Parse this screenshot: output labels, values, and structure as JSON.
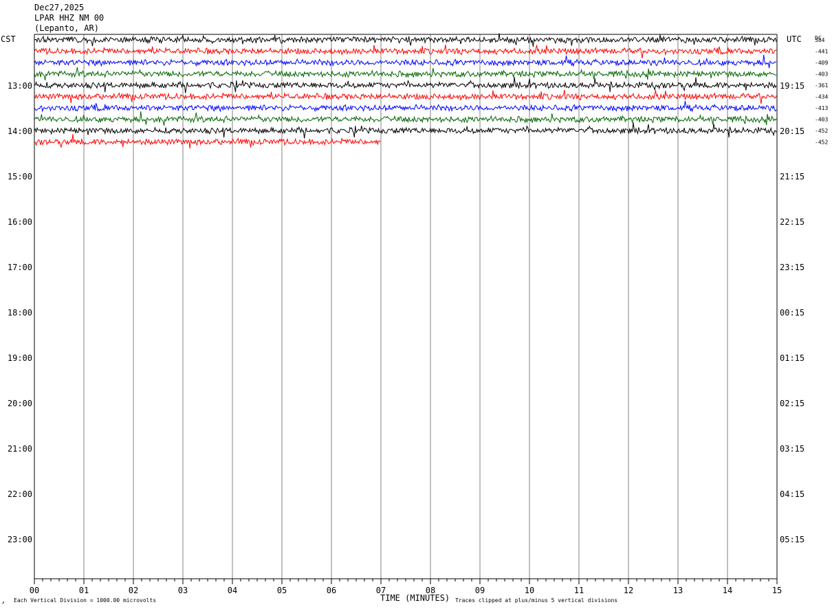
{
  "header": {
    "date": "Dec27,2025",
    "station": "LPAR HHZ NM 00",
    "location": "(Lepanto, AR)"
  },
  "corner": {
    "left_tz": "CST",
    "right_tz": "UTC",
    "dc": "DC"
  },
  "footer": {
    "division_note": "Each Vertical Division = 1000.00 microvolts",
    "clip_note": "Traces clipped at plus/minus 5 vertical divisions",
    "mark": "↗"
  },
  "chart_data": {
    "type": "line",
    "title": "LPAR HHZ NM 00",
    "xlabel": "TIME (MINUTES)",
    "x_ticks": [
      "00",
      "01",
      "02",
      "03",
      "04",
      "05",
      "06",
      "07",
      "08",
      "09",
      "10",
      "11",
      "12",
      "13",
      "14",
      "15"
    ],
    "xlim": [
      0,
      15
    ],
    "grid": true,
    "left_hour_labels": [
      "13:00",
      "14:00",
      "15:00",
      "16:00",
      "17:00",
      "18:00",
      "19:00",
      "20:00",
      "21:00",
      "22:00",
      "23:00"
    ],
    "right_hour_labels": [
      "19:15",
      "20:15",
      "21:15",
      "22:15",
      "23:15",
      "00:15",
      "01:15",
      "02:15",
      "03:15",
      "04:15",
      "05:15"
    ],
    "trace_colors": [
      "#000000",
      "#ff0000",
      "#0000ff",
      "#006400"
    ],
    "traces": [
      {
        "dc": "384",
        "color": "#000000",
        "end_minute": 15
      },
      {
        "dc": "-441",
        "color": "#ff0000",
        "end_minute": 15
      },
      {
        "dc": "-409",
        "color": "#0000ff",
        "end_minute": 15
      },
      {
        "dc": "-403",
        "color": "#006400",
        "end_minute": 15
      },
      {
        "dc": "-361",
        "color": "#000000",
        "end_minute": 15
      },
      {
        "dc": "-434",
        "color": "#ff0000",
        "end_minute": 15
      },
      {
        "dc": "-413",
        "color": "#0000ff",
        "end_minute": 15
      },
      {
        "dc": "-403",
        "color": "#006400",
        "end_minute": 15
      },
      {
        "dc": "-452",
        "color": "#000000",
        "end_minute": 15
      },
      {
        "dc": "-452",
        "color": "#ff0000",
        "end_minute": 7
      }
    ]
  }
}
